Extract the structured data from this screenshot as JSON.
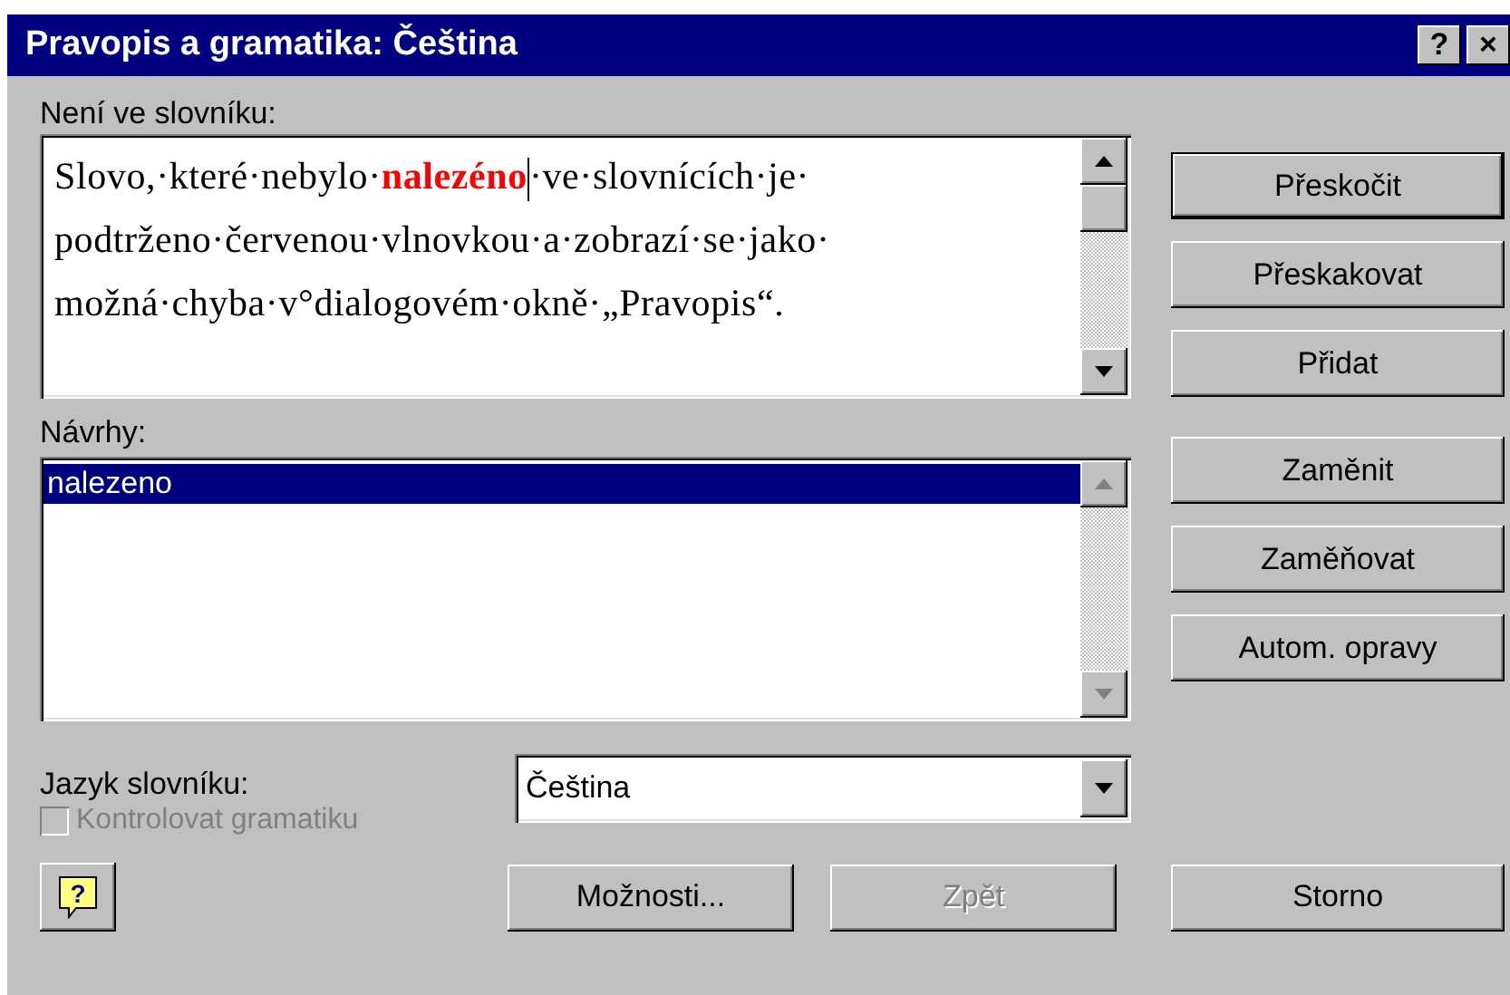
{
  "window": {
    "title": "Pravopis a gramatika: Čeština",
    "title_buttons": [
      "?",
      "×"
    ]
  },
  "not_in_dictionary": {
    "label": "Není ve slovníku:",
    "lines": [
      "Slovo,·které·nebylo·**nalezéno**·ve·slovnících·je·",
      "podtrženo·červenou·vlnovkou·a·zobrazí·se·jako·",
      "možná·chyba·v°dialogovém·okně·„Pravopis“."
    ]
  },
  "suggestions": {
    "label": "Návrhy:",
    "items": [
      {
        "text": "nalezeno",
        "selected": true
      }
    ]
  },
  "side_button_groups": [
    {
      "buttons": [
        {
          "label": "Přeskočit",
          "default": true
        },
        {
          "label": "Přeskakovat",
          "default": false
        },
        {
          "label": "Přidat",
          "default": false
        }
      ]
    },
    {
      "buttons": [
        {
          "label": "Zaměnit",
          "default": false
        },
        {
          "label": "Zaměňovat",
          "default": false
        },
        {
          "label": "Autom. opravy",
          "default": false
        }
      ]
    }
  ],
  "help_button": {
    "label": "?"
  },
  "dictionary_language": {
    "label": "Jazyk slovníku:",
    "value": "Čeština"
  },
  "check_grammar": {
    "label": "Kontrolovat gramatiku",
    "checked": false,
    "disabled": true
  },
  "bottom_buttons": [
    {
      "label": "Možnosti...",
      "disabled": false
    },
    {
      "label": "Zpět",
      "disabled": true
    },
    {
      "label": "Storno",
      "disabled": false
    }
  ]
}
